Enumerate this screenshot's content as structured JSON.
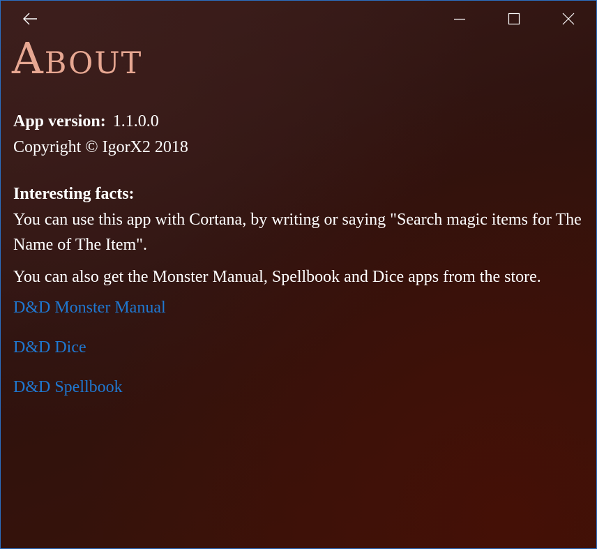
{
  "window": {
    "back_icon": "back-arrow-icon",
    "minimize_icon": "minimize-icon",
    "maximize_icon": "maximize-icon",
    "close_icon": "close-icon"
  },
  "page": {
    "title": "About"
  },
  "app_info": {
    "version_label": "App version:",
    "version_value": "1.1.0.0",
    "copyright": "Copyright © IgorX2 2018"
  },
  "facts": {
    "title": "Interesting facts:",
    "items": [
      "You can use this app with Cortana, by writing or saying \"Search magic items for The Name of The Item\".",
      "You can also get the Monster Manual, Spellbook and Dice apps from the store."
    ]
  },
  "links": [
    "D&D Monster Manual",
    "D&D Dice",
    "D&D Spellbook"
  ],
  "colors": {
    "title": "#e7a792",
    "link": "#1f78d1",
    "text": "#ffffff",
    "border": "#2b6fc2"
  }
}
